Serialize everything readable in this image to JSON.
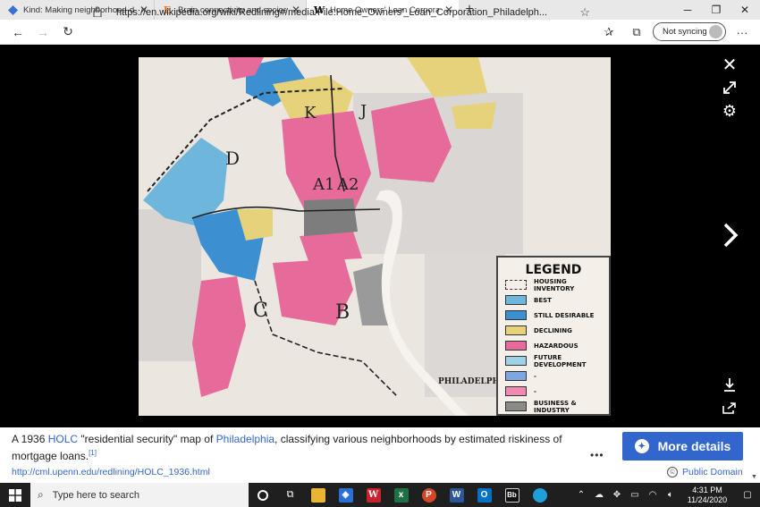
{
  "tabs": [
    {
      "title": "Kind: Making neighborhood-dis",
      "favicon": "diamond-icon",
      "active": false
    },
    {
      "title": "Brain connectivity and socioeco",
      "favicon": "E",
      "active": false
    },
    {
      "title": "Home Owners' Loan Corporation",
      "favicon": "W",
      "active": true
    }
  ],
  "address": {
    "url": "https://en.wikipedia.org/wiki/Redlining#/media/File:Home_Owners'_Loan_Corporation_Philadelph..."
  },
  "profile": {
    "label": "Not syncing"
  },
  "map": {
    "legend_title": "LEGEND",
    "legend_items": [
      {
        "label": "HOUSING INVENTORY",
        "color": "#f4efe8"
      },
      {
        "label": "BEST",
        "color": "#6fb6dc"
      },
      {
        "label": "STILL DESIRABLE",
        "color": "#3c8fd0"
      },
      {
        "label": "DECLINING",
        "color": "#e6d27a"
      },
      {
        "label": "HAZARDOUS",
        "color": "#e66b9a"
      },
      {
        "label": "FUTURE DEVELOPMENT",
        "color": "#9fd2e6"
      },
      {
        "label": "-",
        "color": "#7fa6e0"
      },
      {
        "label": "-",
        "color": "#f08ab0"
      },
      {
        "label": "BUSINESS & INDUSTRY",
        "color": "#8a8a8a"
      }
    ],
    "area_labels": [
      "K",
      "J",
      "D",
      "A1",
      "A2",
      "C",
      "B"
    ],
    "stamp": "PHILADELPHIA CAMDEN"
  },
  "caption": {
    "text_1": "A 1936 ",
    "link_holc": "HOLC",
    "text_2": " \"residential security\" map of ",
    "link_city": "Philadelphia",
    "text_3": ", classifying various neighborhoods by estimated riskiness of mortgage loans.",
    "ref": "[1]",
    "source_url": "http://cml.upenn.edu/redlining/HOLC_1936.html",
    "more_details": "More details",
    "license": "Public Domain"
  },
  "taskbar": {
    "search_placeholder": "Type here to search",
    "time": "4:31 PM",
    "date": "11/24/2020"
  },
  "colors": {
    "accent": "#3366cc",
    "hazardous": "#e66b9a",
    "declining": "#e6d27a",
    "best": "#3c8fd0"
  }
}
